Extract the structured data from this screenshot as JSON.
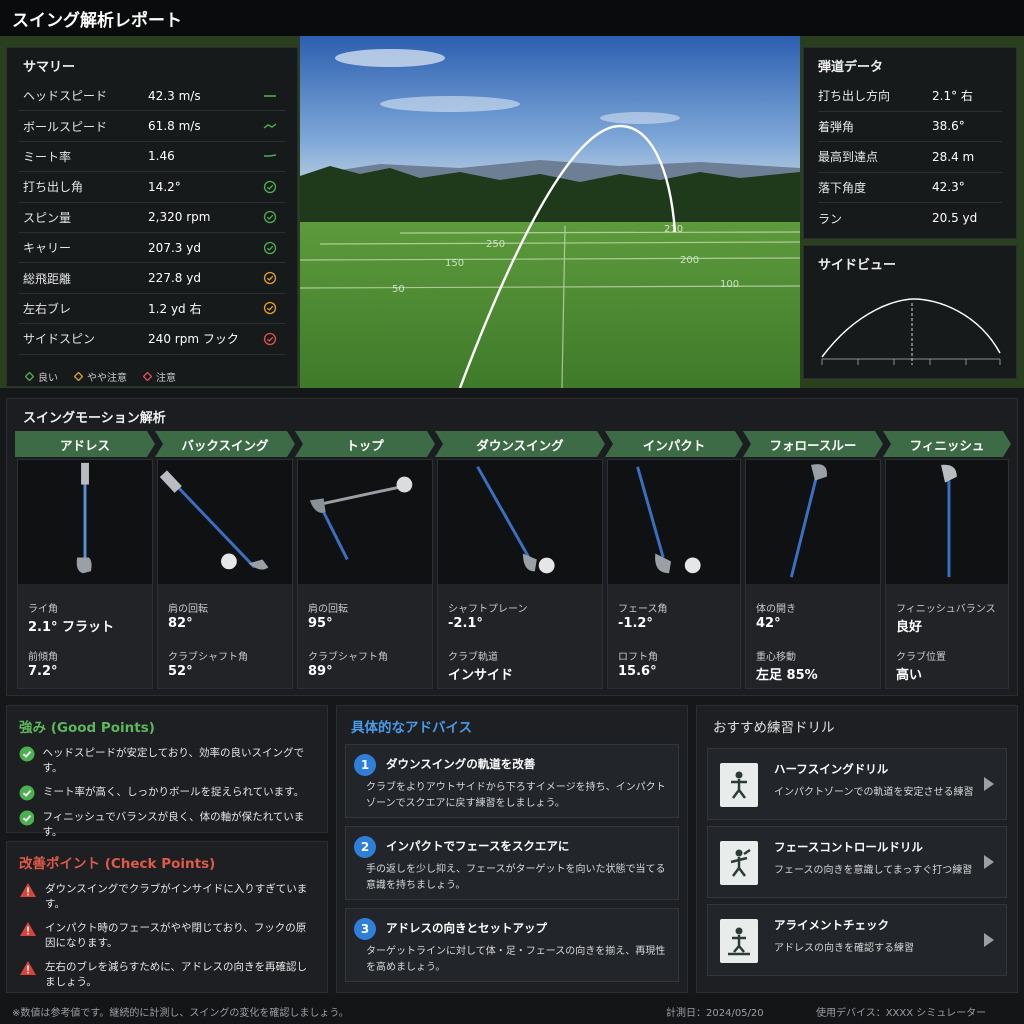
{
  "title": "スイング解析レポート",
  "summary": {
    "title": "サマリー",
    "rows": [
      {
        "label": "ヘッドスピード",
        "value": "42.3 m/s",
        "status_icon": "trend-line-icon"
      },
      {
        "label": "ボールスピード",
        "value": "61.8 m/s",
        "status_icon": "trend-line-icon"
      },
      {
        "label": "ミート率",
        "value": "1.46",
        "status_icon": "trend-line-icon"
      },
      {
        "label": "打ち出し角",
        "value": "14.2°",
        "status_icon": "good-check-icon"
      },
      {
        "label": "スピン量",
        "value": "2,320 rpm",
        "status_icon": "good-check-icon"
      },
      {
        "label": "キャリー",
        "value": "207.3 yd",
        "status_icon": "good-check-icon"
      },
      {
        "label": "総飛距離",
        "value": "227.8 yd",
        "status_icon": "caution-check-icon"
      },
      {
        "label": "左右ブレ",
        "value": "1.2 yd 右",
        "status_icon": "caution-check-icon"
      },
      {
        "label": "サイドスピン",
        "value": "240 rpm フック",
        "status_icon": "alert-check-icon"
      }
    ],
    "legend": {
      "good": "良い",
      "caution": "やや注意",
      "alert": "注意"
    }
  },
  "field": {
    "distance_markers": [
      "50",
      "100",
      "150",
      "200",
      "250",
      "210"
    ]
  },
  "trajectory": {
    "title": "弾道データ",
    "rows": [
      {
        "label": "打ち出し方向",
        "value": "2.1° 右"
      },
      {
        "label": "着弾角",
        "value": "38.6°"
      },
      {
        "label": "最高到達点",
        "value": "28.4 m"
      },
      {
        "label": "落下角度",
        "value": "42.3°"
      },
      {
        "label": "ラン",
        "value": "20.5 yd"
      }
    ]
  },
  "side_view": {
    "title": "サイドビュー"
  },
  "motion": {
    "title": "スイングモーション解析",
    "phases": [
      {
        "name": "アドレス",
        "m1": "ライ角",
        "v1": "2.1° フラット",
        "m2": "前傾角",
        "v2": "7.2°"
      },
      {
        "name": "バックスイング",
        "m1": "肩の回転",
        "v1": "82°",
        "m2": "クラブシャフト角",
        "v2": "52°"
      },
      {
        "name": "トップ",
        "m1": "肩の回転",
        "v1": "95°",
        "m2": "クラブシャフト角",
        "v2": "89°"
      },
      {
        "name": "ダウンスイング",
        "m1": "シャフトプレーン",
        "v1": "-2.1°",
        "m2": "クラブ軌道",
        "v2": "インサイド"
      },
      {
        "name": "インパクト",
        "m1": "フェース角",
        "v1": "-1.2°",
        "m2": "ロフト角",
        "v2": "15.6°"
      },
      {
        "name": "フォロースルー",
        "m1": "体の開き",
        "v1": "42°",
        "m2": "重心移動",
        "v2": "左足 85%"
      },
      {
        "name": "フィニッシュ",
        "m1": "フィニッシュバランス",
        "v1": "良好",
        "m2": "クラブ位置",
        "v2": "高い"
      }
    ]
  },
  "good_points": {
    "title": "強み (Good Points)",
    "items": [
      "ヘッドスピードが安定しており、効率の良いスイングです。",
      "ミート率が高く、しっかりボールを捉えられています。",
      "フィニッシュでバランスが良く、体の軸が保たれています。"
    ]
  },
  "check_points": {
    "title": "改善ポイント (Check Points)",
    "items": [
      "ダウンスイングでクラブがインサイドに入りすぎています。",
      "インパクト時のフェースがやや閉じており、フックの原因になります。",
      "左右のブレを減らすために、アドレスの向きを再確認しましょう。"
    ]
  },
  "advice": {
    "title": "具体的なアドバイス",
    "items": [
      {
        "num": "1",
        "title": "ダウンスイングの軌道を改善",
        "text": "クラブをよりアウトサイドから下ろすイメージを持ち、インパクトゾーンでスクエアに戻す練習をしましょう。"
      },
      {
        "num": "2",
        "title": "インパクトでフェースをスクエアに",
        "text": "手の返しを少し抑え、フェースがターゲットを向いた状態で当てる意識を持ちましょう。"
      },
      {
        "num": "3",
        "title": "アドレスの向きとセットアップ",
        "text": "ターゲットラインに対して体・足・フェースの向きを揃え、再現性を高めましょう。"
      }
    ]
  },
  "drills": {
    "title": "おすすめ練習ドリル",
    "items": [
      {
        "title": "ハーフスイングドリル",
        "desc": "インパクトゾーンでの軌道を安定させる練習",
        "icon": "half-swing-drill-icon"
      },
      {
        "title": "フェースコントロールドリル",
        "desc": "フェースの向きを意識してまっすぐ打つ練習",
        "icon": "face-control-drill-icon"
      },
      {
        "title": "アライメントチェック",
        "desc": "アドレスの向きを確認する練習",
        "icon": "alignment-check-icon"
      }
    ]
  },
  "footer": {
    "note": "※数値は参考値です。継続的に計測し、スイングの変化を確認しましょう。",
    "date": "計測日：2024/05/20",
    "device": "使用デバイス：XXXX シミュレーター"
  },
  "colors": {
    "good": "#4caf50",
    "caution": "#e0a030",
    "alert": "#e05050",
    "phase_header": "#3d6b45",
    "advice_number": "#2f7fd8"
  }
}
